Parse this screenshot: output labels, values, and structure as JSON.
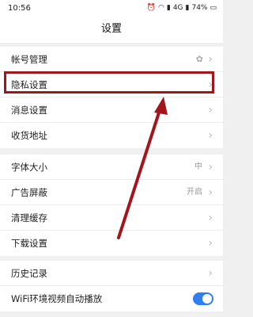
{
  "status": {
    "time": "10:56",
    "signal": "4G",
    "battery": "74%"
  },
  "title": "设置",
  "group1": [
    {
      "label": "帐号管理",
      "icon": "clover-icon"
    },
    {
      "label": "隐私设置"
    },
    {
      "label": "消息设置"
    },
    {
      "label": "收货地址"
    }
  ],
  "group2": [
    {
      "label": "字体大小",
      "value": "中"
    },
    {
      "label": "广告屏蔽",
      "value": "开启"
    },
    {
      "label": "清理缓存"
    },
    {
      "label": "下载设置"
    }
  ],
  "group3": [
    {
      "label": "历史记录"
    },
    {
      "label": "WiFi环境视频自动播放",
      "toggle": true
    }
  ],
  "annotation": {
    "color": "#a2151d"
  }
}
